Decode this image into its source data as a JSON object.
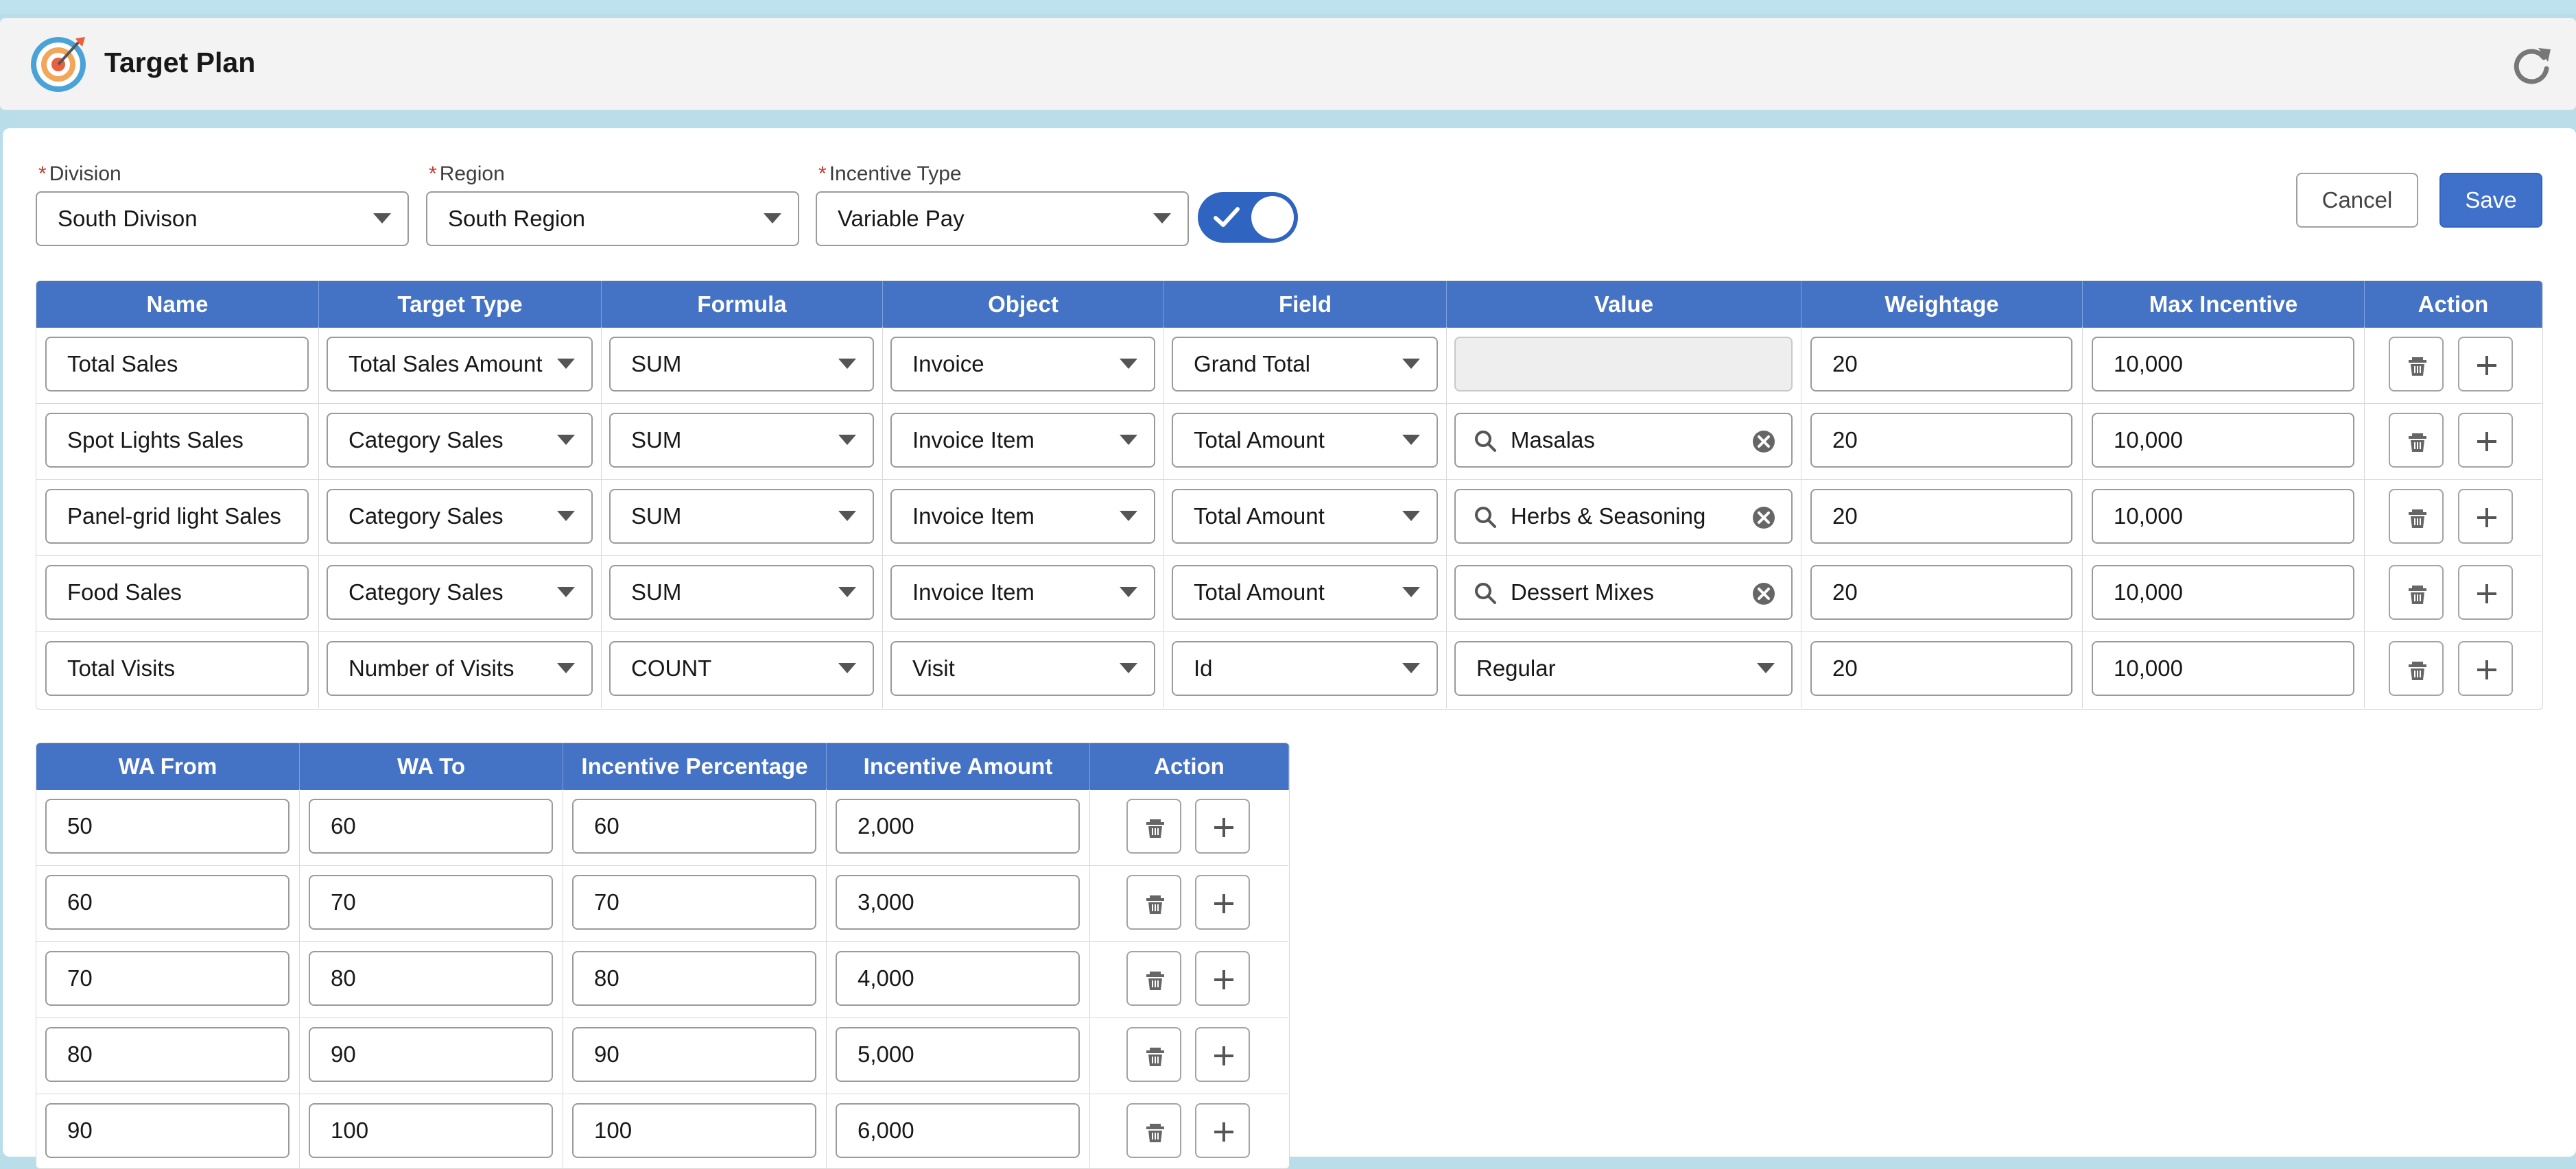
{
  "header": {
    "title": "Target Plan"
  },
  "filters": {
    "division": {
      "label": "Division",
      "value": "South Divison"
    },
    "region": {
      "label": "Region",
      "value": "South Region"
    },
    "incentive_type": {
      "label": "Incentive Type",
      "value": "Variable Pay"
    },
    "toggle_on": true
  },
  "actions": {
    "cancel": "Cancel",
    "save": "Save"
  },
  "targets": {
    "columns": [
      "Name",
      "Target Type",
      "Formula",
      "Object",
      "Field",
      "Value",
      "Weightage",
      "Max Incentive",
      "Action"
    ],
    "rows": [
      {
        "name": "Total Sales",
        "target_type": "Total Sales Amount",
        "formula": "SUM",
        "object": "Invoice",
        "field": "Grand Total",
        "value": "",
        "value_kind": "disabled",
        "weightage": "20",
        "max_incentive": "10,000"
      },
      {
        "name": "Spot Lights Sales",
        "target_type": "Category Sales",
        "formula": "SUM",
        "object": "Invoice Item",
        "field": "Total Amount",
        "value": "Masalas",
        "value_kind": "lookup",
        "weightage": "20",
        "max_incentive": "10,000"
      },
      {
        "name": "Panel-grid light Sales",
        "target_type": "Category Sales",
        "formula": "SUM",
        "object": "Invoice Item",
        "field": "Total Amount",
        "value": "Herbs & Seasoning",
        "value_kind": "lookup",
        "weightage": "20",
        "max_incentive": "10,000"
      },
      {
        "name": "Food Sales",
        "target_type": "Category Sales",
        "formula": "SUM",
        "object": "Invoice Item",
        "field": "Total Amount",
        "value": "Dessert Mixes",
        "value_kind": "lookup",
        "weightage": "20",
        "max_incentive": "10,000"
      },
      {
        "name": "Total Visits",
        "target_type": "Number of Visits",
        "formula": "COUNT",
        "object": "Visit",
        "field": "Id",
        "value": "Regular",
        "value_kind": "select",
        "weightage": "20",
        "max_incentive": "10,000"
      }
    ]
  },
  "slabs": {
    "columns": [
      "WA From",
      "WA To",
      "Incentive Percentage",
      "Incentive Amount",
      "Action"
    ],
    "rows": [
      {
        "from": "50",
        "to": "60",
        "percentage": "60",
        "amount": "2,000"
      },
      {
        "from": "60",
        "to": "70",
        "percentage": "70",
        "amount": "3,000"
      },
      {
        "from": "70",
        "to": "80",
        "percentage": "80",
        "amount": "4,000"
      },
      {
        "from": "80",
        "to": "90",
        "percentage": "90",
        "amount": "5,000"
      },
      {
        "from": "90",
        "to": "100",
        "percentage": "100",
        "amount": "6,000"
      }
    ]
  },
  "icons": {
    "logo": "target-icon",
    "refresh": "refresh-icon",
    "delete": "trash-icon",
    "add": "plus-icon",
    "search": "search-icon",
    "clear": "clear-icon",
    "check": "check-icon"
  },
  "colors": {
    "accent": "#4472c4",
    "save_button": "#3f71cb",
    "toggle": "#2f64c0",
    "required": "#c23934"
  }
}
